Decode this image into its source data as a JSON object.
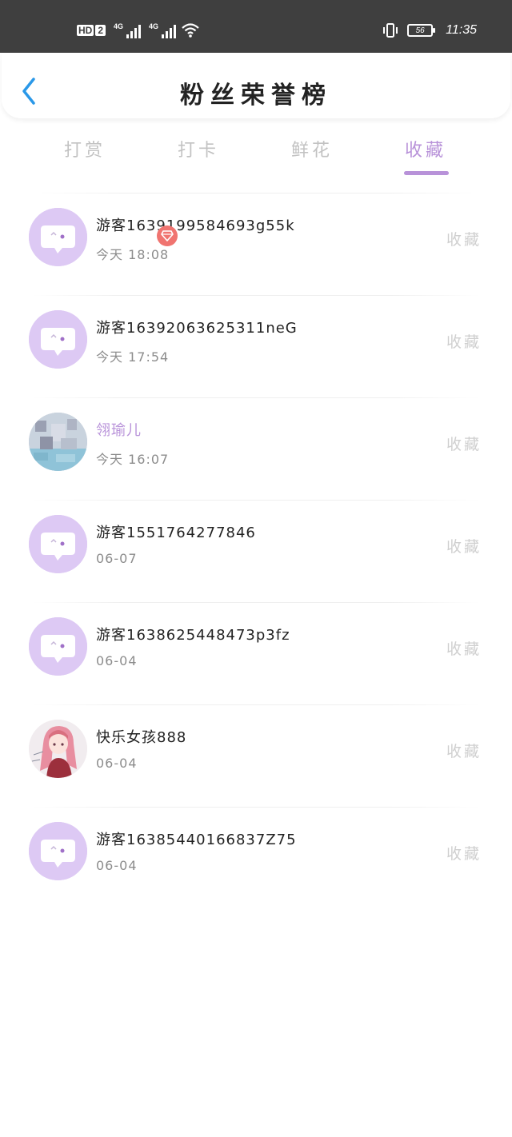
{
  "status_bar": {
    "hd_label": "HD",
    "sim_number": "2",
    "network_1": "4G",
    "network_2": "4G",
    "battery": "56",
    "time": "11:35"
  },
  "header": {
    "title": "粉丝荣誉榜",
    "back_icon": "chevron-left-icon"
  },
  "tabs": [
    {
      "label": "打赏",
      "active": false
    },
    {
      "label": "打卡",
      "active": false
    },
    {
      "label": "鲜花",
      "active": false
    },
    {
      "label": "收藏",
      "active": true
    }
  ],
  "colors": {
    "accent": "#b892d9",
    "avatar_bg": "#ddc9f4",
    "vip_badge": "#f07470",
    "back_icon": "#2a98e8"
  },
  "fans": [
    {
      "name": "游客1639199584693g55k",
      "time": "今天 18:08",
      "action": "收藏",
      "avatar": "default-avatar-icon"
    },
    {
      "name": "游客16392063625311neG",
      "time": "今天 17:54",
      "action": "收藏",
      "avatar": "default-avatar-icon"
    },
    {
      "name": "翎瑜儿",
      "time": "今天 16:07",
      "action": "收藏",
      "avatar": "user-photo",
      "vip": true
    },
    {
      "name": "游客1551764277846",
      "time": "06-07",
      "action": "收藏",
      "avatar": "default-avatar-icon"
    },
    {
      "name": "游客1638625448473p3fz",
      "time": "06-04",
      "action": "收藏",
      "avatar": "default-avatar-icon"
    },
    {
      "name": "快乐女孩888",
      "time": "06-04",
      "action": "收藏",
      "avatar": "anime-girl-photo"
    },
    {
      "name": "游客16385440166837Z75",
      "time": "06-04",
      "action": "收藏",
      "avatar": "default-avatar-icon"
    }
  ]
}
